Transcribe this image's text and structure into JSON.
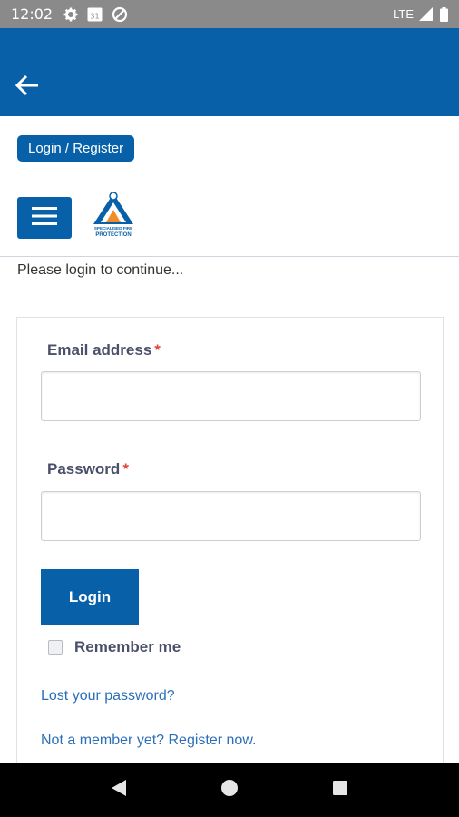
{
  "status_bar": {
    "time": "12:02",
    "network": "LTE",
    "calendar_day": "31",
    "icons": [
      "gear-icon",
      "calendar-icon",
      "data-saver-icon",
      "signal-icon",
      "battery-icon"
    ]
  },
  "header": {
    "back_icon": "arrow-left-icon",
    "breadcrumb_label": "Login / Register",
    "menu_icon": "hamburger-menu-icon",
    "logo_text_top": "SPECIALISED FIRE",
    "logo_text_bottom": "PROTECTION"
  },
  "page": {
    "intro": "Please login to continue..."
  },
  "form": {
    "email_label": "Email address",
    "password_label": "Password",
    "required_marker": "*",
    "email_value": "",
    "password_value": "",
    "login_button": "Login",
    "remember_label": "Remember me",
    "remember_checked": false,
    "lost_password_link": "Lost your password?",
    "register_link": "Not a member yet? Register now."
  },
  "colors": {
    "brand_blue": "#0861a8",
    "required_red": "#e0433a",
    "link_blue": "#2c6fb8",
    "status_bar_gray": "#8a8a8a"
  },
  "nav_bar": {
    "icons": [
      "back-triangle-icon",
      "home-circle-icon",
      "recents-square-icon"
    ]
  }
}
